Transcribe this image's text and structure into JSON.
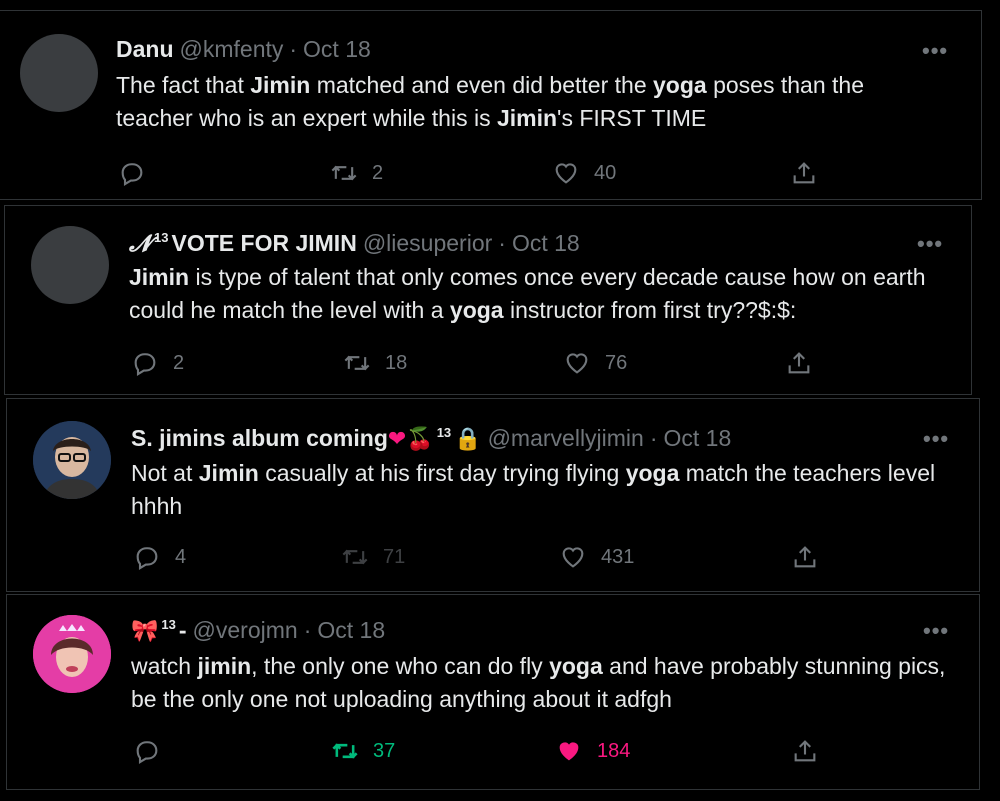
{
  "tweets": [
    {
      "name": "Danu",
      "handle": "@kmfenty",
      "date": "Oct 18",
      "text_parts": [
        "The fact that ",
        "Jimin",
        " matched and even did better the ",
        "yoga",
        " poses than the teacher who is an expert while this is ",
        "Jimin",
        "'s FIRST TIME"
      ],
      "reply_count": "",
      "retweet_count": "2",
      "like_count": "40"
    },
    {
      "name_prefix": "𝓝",
      "name_sup": "13",
      "name": "VOTE FOR JIMIN",
      "handle": "@liesuperior",
      "date": "Oct 18",
      "text_parts": [
        "Jimin",
        " is type of talent that only comes once every decade cause how on earth could he match the level with a ",
        "yoga",
        " instructor from first try??$:$:"
      ],
      "reply_count": "2",
      "retweet_count": "18",
      "like_count": "76"
    },
    {
      "name": "S. jimins album coming",
      "name_emoji": "❤🍒",
      "name_sup": "13",
      "name_lock": "🔒",
      "handle": "@marvellyjimin",
      "date": "Oct 18",
      "text_parts": [
        "Not at ",
        "Jimin",
        " casually at his first day trying flying ",
        "yoga",
        " match the teachers level hhhh"
      ],
      "reply_count": "4",
      "retweet_count": "71",
      "like_count": "431"
    },
    {
      "name_emoji": "🎀",
      "name_sup": "13",
      "name": "-",
      "handle": "@verojmn",
      "date": "Oct 18",
      "text_parts": [
        "watch ",
        "jimin",
        ", the only one who can do fly ",
        "yoga",
        " and have probably stunning pics, be the only one not uploading anything about it adfgh"
      ],
      "reply_count": "",
      "retweet_count": "37",
      "like_count": "184"
    }
  ],
  "separator": "·",
  "more_label": "•••",
  "colors": {
    "retweet_active": "#00ba7c",
    "like_active": "#f91880",
    "muted": "#71767b"
  }
}
